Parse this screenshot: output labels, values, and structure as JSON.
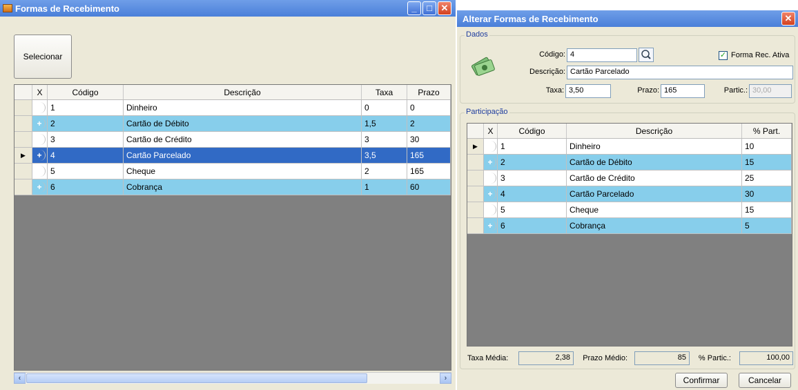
{
  "left_window": {
    "title": "Formas de Recebimento",
    "select_button": "Selecionar",
    "columns": [
      "X",
      "Código",
      "Descrição",
      "Taxa",
      "Prazo"
    ],
    "rows": [
      {
        "code": "1",
        "desc": "Dinheiro",
        "taxa": "0",
        "prazo": "0"
      },
      {
        "code": "2",
        "desc": "Cartão de Débito",
        "taxa": "1,5",
        "prazo": "2"
      },
      {
        "code": "3",
        "desc": "Cartão de Crédito",
        "taxa": "3",
        "prazo": "30"
      },
      {
        "code": "4",
        "desc": "Cartão Parcelado",
        "taxa": "3,5",
        "prazo": "165"
      },
      {
        "code": "5",
        "desc": "Cheque",
        "taxa": "2",
        "prazo": "165"
      },
      {
        "code": "6",
        "desc": "Cobrança",
        "taxa": "1",
        "prazo": "60"
      }
    ],
    "selected_row": 3
  },
  "right_window": {
    "title": "Alterar Formas de Recebimento",
    "dados": {
      "group_label": "Dados",
      "codigo_label": "Código:",
      "codigo_value": "4",
      "forma_ativa_label": "Forma Rec. Ativa",
      "forma_ativa_checked": true,
      "descricao_label": "Descrição:",
      "descricao_value": "Cartão Parcelado",
      "taxa_label": "Taxa:",
      "taxa_value": "3,50",
      "prazo_label": "Prazo:",
      "prazo_value": "165",
      "partic_label": "Partic.:",
      "partic_value": "30,00"
    },
    "participacao": {
      "group_label": "Participação",
      "columns": [
        "X",
        "Código",
        "Descrição",
        "% Part."
      ],
      "rows": [
        {
          "code": "1",
          "desc": "Dinheiro",
          "part": "10"
        },
        {
          "code": "2",
          "desc": "Cartão de Débito",
          "part": "15"
        },
        {
          "code": "3",
          "desc": "Cartão de Crédito",
          "part": "25"
        },
        {
          "code": "4",
          "desc": "Cartão Parcelado",
          "part": "30"
        },
        {
          "code": "5",
          "desc": "Cheque",
          "part": "15"
        },
        {
          "code": "6",
          "desc": "Cobrança",
          "part": "5"
        }
      ]
    },
    "footer": {
      "taxa_media_label": "Taxa Média:",
      "taxa_media_value": "2,38",
      "prazo_medio_label": "Prazo Médio:",
      "prazo_medio_value": "85",
      "partic_label": "% Partic.:",
      "partic_value": "100,00"
    },
    "confirm_button": "Confirmar",
    "cancel_button": "Cancelar"
  },
  "colors": {
    "selected": "#316ac5",
    "alt_row": "#87ceeb",
    "titlebar": "#4a7fd9"
  }
}
